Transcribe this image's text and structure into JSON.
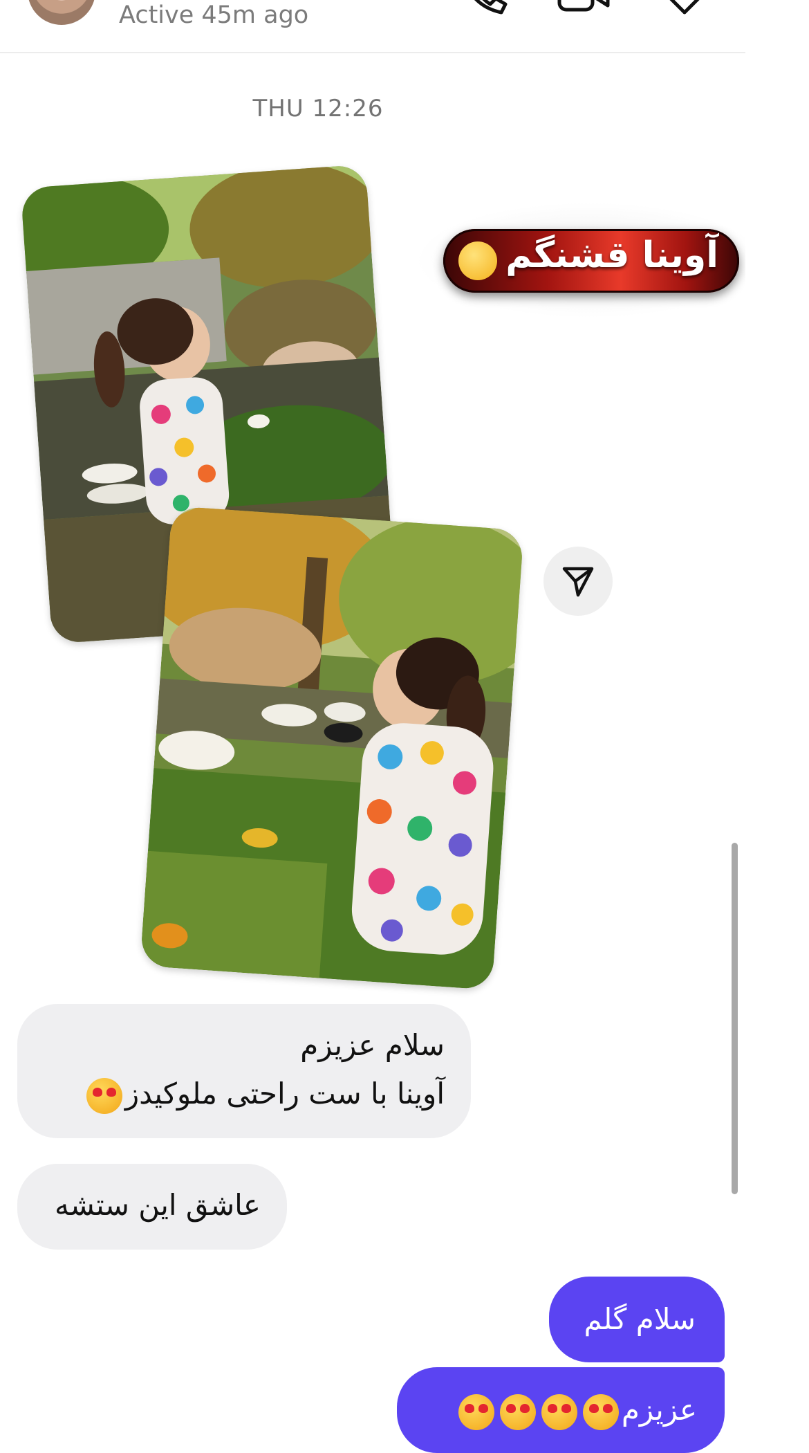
{
  "header": {
    "status": "Active 45m ago",
    "icons": [
      "phone-icon",
      "video-icon",
      "tag-icon"
    ]
  },
  "thread": {
    "timestamp": "THU 12:26",
    "sticker_text": "آوینا قشنگم",
    "sticker_emoji": "smiling-face-with-hearts",
    "messages": [
      {
        "side": "incoming",
        "lines": [
          "سلام عزیزم",
          "آوینا با ست راحتی ملوکیدز"
        ]
      },
      {
        "side": "incoming",
        "lines": [
          "عاشق این ستشه"
        ]
      },
      {
        "side": "outgoing",
        "lines": [
          "سلام گلم"
        ]
      },
      {
        "side": "outgoing",
        "lines": [
          "عزیزم"
        ]
      }
    ]
  },
  "colors": {
    "outgoing_bubble": "#5b44f2",
    "incoming_bubble": "#efeff1",
    "sticker_red": "#e83a2a"
  }
}
